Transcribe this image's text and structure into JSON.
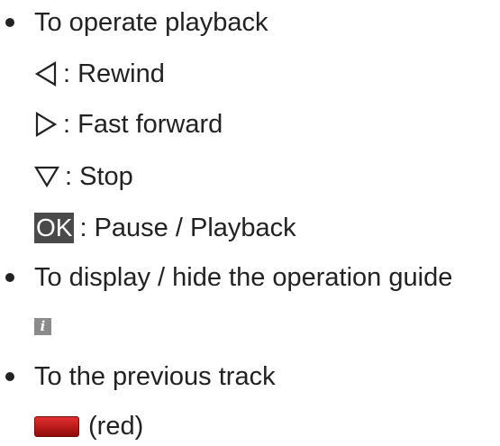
{
  "sections": {
    "playback": {
      "heading": "To operate playback",
      "items": [
        {
          "icon": "triangle-left-icon",
          "label": ": Rewind"
        },
        {
          "icon": "triangle-right-icon",
          "label": ": Fast forward"
        },
        {
          "icon": "triangle-down-icon",
          "label": ": Stop"
        },
        {
          "key": "OK",
          "label": ": Pause / Playback"
        }
      ]
    },
    "guide": {
      "heading": "To display / hide the operation guide",
      "key_glyph": "i"
    },
    "previous": {
      "heading": "To the previous track",
      "key_color": "#c01f1f",
      "label": "(red)"
    }
  }
}
